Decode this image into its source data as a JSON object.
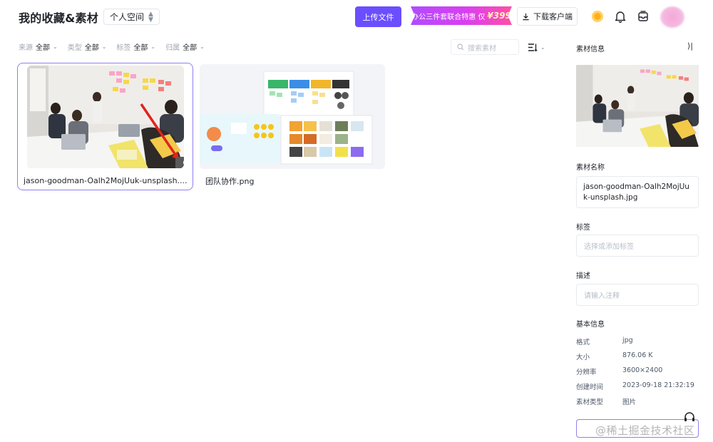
{
  "header": {
    "title": "我的收藏&素材",
    "space_label": "个人空间",
    "upload_label": "上传文件",
    "promo_text": "办公三件套联合特惠 仅",
    "promo_price": "¥399",
    "download_label": "下载客户端"
  },
  "filters": [
    {
      "label": "来源",
      "value": "全部"
    },
    {
      "label": "类型",
      "value": "全部"
    },
    {
      "label": "标签",
      "value": "全部"
    },
    {
      "label": "归属",
      "value": "全部"
    }
  ],
  "search": {
    "placeholder": "搜索素材"
  },
  "cards": [
    {
      "name": "jason-goodman-Oalh2MojUuk-unsplash....",
      "selected": true
    },
    {
      "name": "团队协作.png",
      "selected": false
    }
  ],
  "panel": {
    "title": "素材信息",
    "name_label": "素材名称",
    "name_value": "jason-goodman-Oalh2MojUuk-unsplash.jpg",
    "tags_label": "标签",
    "tags_placeholder": "选择或添加标签",
    "desc_label": "描述",
    "desc_placeholder": "请输入注释",
    "basic_info_label": "基本信息",
    "info": [
      {
        "key": "格式",
        "value": "jpg"
      },
      {
        "key": "大小",
        "value": "876.06 K"
      },
      {
        "key": "分辨率",
        "value": "3600×2400"
      },
      {
        "key": "创建时间",
        "value": "2023-09-18 21:32:19"
      },
      {
        "key": "素材类型",
        "value": "图片"
      }
    ]
  },
  "watermark": "@稀土掘金技术社区",
  "colors": {
    "accent": "#6b4eff",
    "selected_border": "#8f7ff0",
    "coin": "#ffb020"
  }
}
